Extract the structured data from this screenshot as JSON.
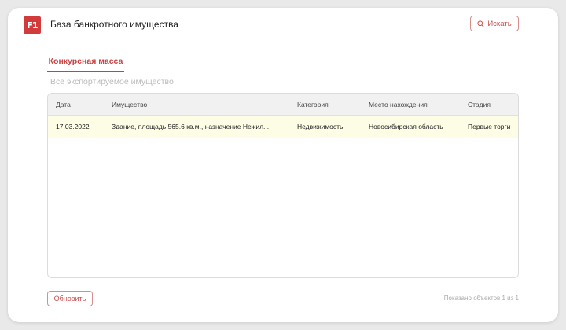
{
  "header": {
    "logo_text": "F1",
    "title": "База банкротного имущества",
    "search_label": "Искать",
    "search_icon": "search-icon"
  },
  "tabs": [
    {
      "label": "Конкурсная масса",
      "active": true
    }
  ],
  "subtitle": "Всё экспортируемое имущество",
  "table": {
    "columns": [
      "Дата",
      "Имущество",
      "Категория",
      "Место нахождения",
      "Стадия"
    ],
    "rows": [
      {
        "date": "17.03.2022",
        "property": "Здание, площадь 565.6 кв.м., назначение Нежил...",
        "category": "Недвижимость",
        "location": "Новосибирская область",
        "stage": "Первые торги"
      }
    ]
  },
  "footer": {
    "refresh_label": "Обновить",
    "count_text": "Показано объектов 1 из 1"
  },
  "colors": {
    "accent": "#c94040",
    "row_highlight": "#fdfde6",
    "header_bg": "#f1f1f2"
  }
}
